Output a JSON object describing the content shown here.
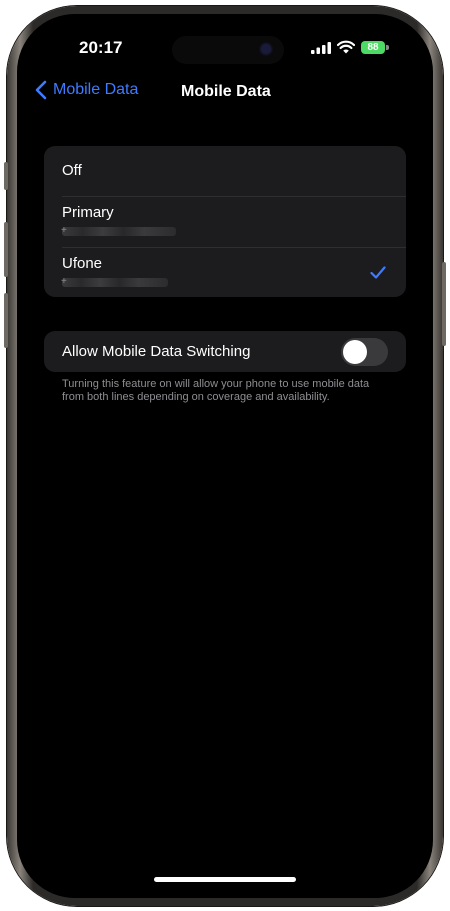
{
  "status_bar": {
    "time": "20:17",
    "battery": "88"
  },
  "nav": {
    "back_label": "Mobile Data",
    "title": "Mobile Data"
  },
  "options": [
    {
      "label": "Off",
      "selected": false
    },
    {
      "label": "Primary",
      "number_prefix": "+",
      "selected": false
    },
    {
      "label": "Ufone",
      "number_prefix": "+",
      "selected": true
    }
  ],
  "switching": {
    "label": "Allow Mobile Data Switching",
    "enabled": false,
    "footnote": "Turning this feature on will allow your phone to use mobile data from both lines depending on coverage and availability."
  },
  "colors": {
    "accent": "#3f7bff",
    "background": "#000000",
    "group_background": "#1c1c1e",
    "battery": "#4cd964"
  },
  "icons": {
    "back": "chevron-left-icon",
    "selected": "checkmark-icon",
    "signal": "cellular-signal-icon",
    "wifi": "wifi-icon",
    "battery": "battery-icon"
  }
}
